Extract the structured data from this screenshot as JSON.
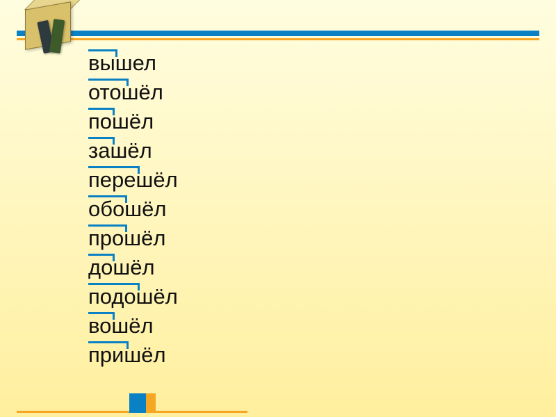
{
  "words": [
    {
      "text": "вышел",
      "prefix_left": 0,
      "prefix_width": 42
    },
    {
      "text": "отошёл",
      "prefix_left": 0,
      "prefix_width": 58
    },
    {
      "text": "пошёл",
      "prefix_left": 0,
      "prefix_width": 38
    },
    {
      "text": "зашёл",
      "prefix_left": 0,
      "prefix_width": 38
    },
    {
      "text": "перешёл",
      "prefix_left": 0,
      "prefix_width": 74
    },
    {
      "text": "обошёл",
      "prefix_left": 0,
      "prefix_width": 56
    },
    {
      "text": "прошёл",
      "prefix_left": 0,
      "prefix_width": 56
    },
    {
      "text": "дошёл",
      "prefix_left": 0,
      "prefix_width": 38
    },
    {
      "text": "подошёл",
      "prefix_left": 0,
      "prefix_width": 74
    },
    {
      "text": "вошёл",
      "prefix_left": 0,
      "prefix_width": 38
    },
    {
      "text": "пришёл",
      "prefix_left": 0,
      "prefix_width": 58
    }
  ],
  "colors": {
    "accent_blue": "#0a81c4",
    "accent_orange": "#f5a623"
  }
}
